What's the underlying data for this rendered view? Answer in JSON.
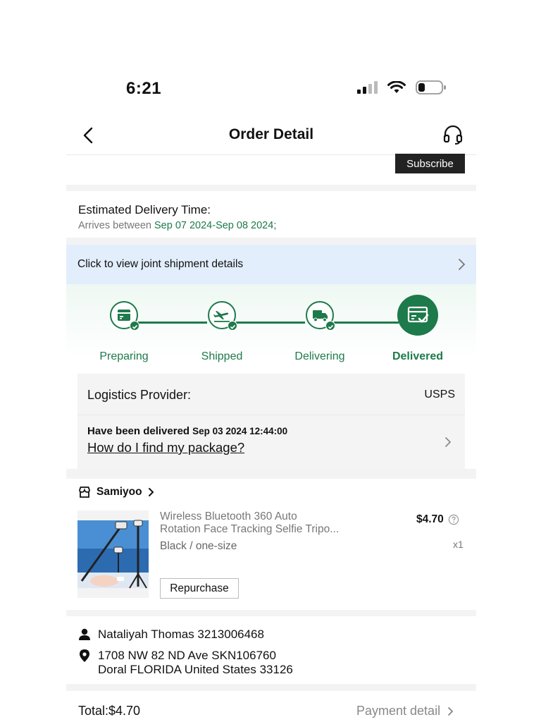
{
  "status_bar": {
    "time": "6:21"
  },
  "nav": {
    "title": "Order Detail"
  },
  "subscribe": {
    "label": "Subscribe"
  },
  "delivery": {
    "title": "Estimated Delivery Time:",
    "arrives_prefix": "Arrives between ",
    "arrives_range": "Sep 07 2024-Sep 08 2024;"
  },
  "joint_shipment": {
    "label": "Click to view joint shipment details"
  },
  "progress": {
    "steps": [
      {
        "label": "Preparing",
        "icon": "package-icon"
      },
      {
        "label": "Shipped",
        "icon": "airplane-icon"
      },
      {
        "label": "Delivering",
        "icon": "truck-icon"
      },
      {
        "label": "Delivered",
        "icon": "delivered-box-icon"
      }
    ],
    "active_step": 4
  },
  "logistics": {
    "provider_label": "Logistics Provider:",
    "provider_value": "USPS",
    "status": "Have been delivered",
    "status_time": "Sep 03 2024 12:44:00",
    "help_link": "How do I find my package?"
  },
  "store": {
    "name": "Samiyoo"
  },
  "product": {
    "title_line1": "Wireless Bluetooth 360 Auto",
    "title_line2": "Rotation Face Tracking Selfie Tripo...",
    "variant": "Black / one-size",
    "price": "$4.70",
    "qty": "x1",
    "repurchase_label": "Repurchase"
  },
  "address": {
    "contact": "Nataliyah Thomas 3213006468",
    "line1": "1708 NW 82 ND Ave SKN106760",
    "line2": "Doral FLORIDA United States 33126"
  },
  "footer": {
    "total": "Total:$4.70",
    "payment_detail": "Payment detail"
  },
  "colors": {
    "accent_green": "#1d7a4a",
    "joint_bg": "#e3eefc",
    "subscribe_bg": "#222222"
  }
}
